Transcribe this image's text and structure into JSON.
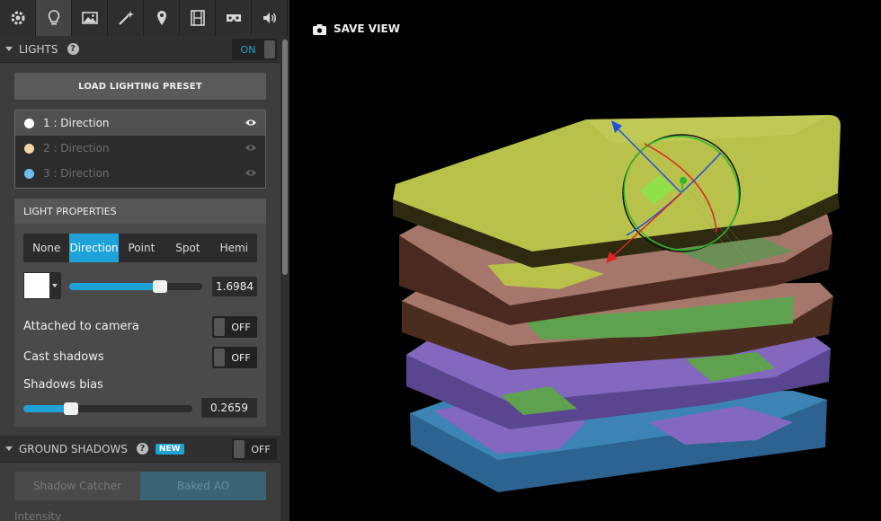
{
  "toolbar": {
    "tools": [
      {
        "name": "gear-icon"
      },
      {
        "name": "lightbulb-icon",
        "active": true
      },
      {
        "name": "image-icon"
      },
      {
        "name": "magic-wand-icon"
      },
      {
        "name": "map-pin-icon"
      },
      {
        "name": "film-icon"
      },
      {
        "name": "vr-headset-icon"
      },
      {
        "name": "speaker-icon"
      }
    ]
  },
  "lights": {
    "title": "LIGHTS",
    "toggle": "ON",
    "load_preset": "LOAD LIGHTING PRESET",
    "items": [
      {
        "label": "1 : Direction",
        "color": "#ffffff"
      },
      {
        "label": "2 : Direction",
        "color": "#f4d3aa"
      },
      {
        "label": "3 : Direction",
        "color": "#6fbfee"
      }
    ]
  },
  "light_properties": {
    "title": "LIGHT PROPERTIES",
    "types": [
      "None",
      "Direction",
      "Point",
      "Spot",
      "Hemi"
    ],
    "selected_type": "Direction",
    "color": "#ffffff",
    "intensity": {
      "value": "1.6984",
      "fraction": 0.68
    },
    "attached_to_camera": {
      "label": "Attached to camera",
      "state": "OFF"
    },
    "cast_shadows": {
      "label": "Cast shadows",
      "state": "OFF"
    },
    "shadows_bias": {
      "label": "Shadows bias",
      "value": "0.2659",
      "fraction": 0.28
    }
  },
  "ground_shadows": {
    "title": "GROUND SHADOWS",
    "badge": "NEW",
    "toggle": "OFF",
    "tabs": [
      "Shadow Catcher",
      "Baked AO"
    ],
    "next_label": "Intensity"
  },
  "viewport": {
    "save_view": "SAVE VIEW"
  },
  "colors": {
    "accent": "#1fa2d8",
    "layer_top": "#b8c24a",
    "layer_brown": "#a5766a",
    "layer_green": "#5ea14e",
    "layer_purple": "#8468c0",
    "layer_blue": "#3d84b6"
  }
}
